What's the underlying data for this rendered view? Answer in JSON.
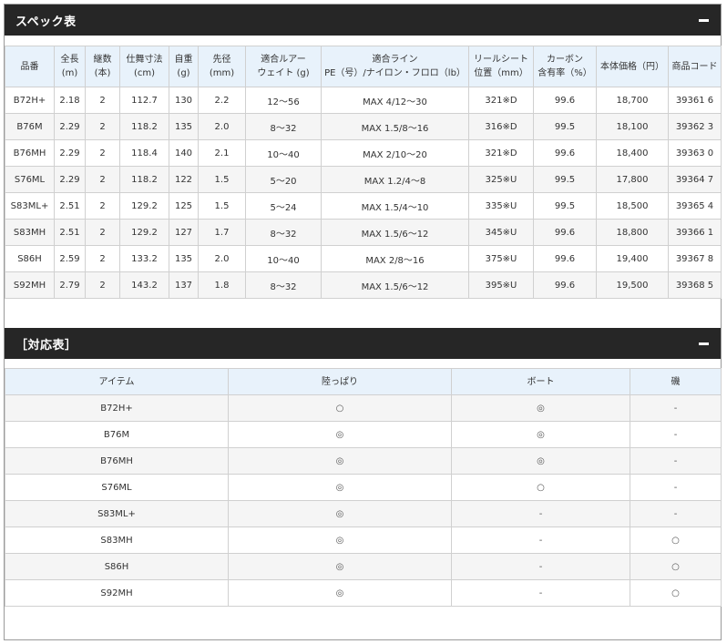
{
  "spec": {
    "title": "スペック表",
    "headers": [
      [
        "品番"
      ],
      [
        "全長",
        "(m)"
      ],
      [
        "継数",
        "(本)"
      ],
      [
        "仕舞寸法",
        "(cm)"
      ],
      [
        "自重",
        "(g)"
      ],
      [
        "先径",
        "(mm)"
      ],
      [
        "適合ルアー",
        "ウェイト (g)"
      ],
      [
        "適合ライン",
        "PE（号）/ナイロン・フロロ（lb）"
      ],
      [
        "リールシート",
        "位置（mm）"
      ],
      [
        "カーボン",
        "含有率（%）"
      ],
      [
        "本体価格（円）"
      ],
      [
        "商品コード"
      ]
    ],
    "rows": [
      [
        "B72H+",
        "2.18",
        "2",
        "112.7",
        "130",
        "2.2",
        "12～56",
        "MAX 4/12～30",
        "321※D",
        "99.6",
        "18,700",
        "39361 6"
      ],
      [
        "B76M",
        "2.29",
        "2",
        "118.2",
        "135",
        "2.0",
        "8～32",
        "MAX 1.5/8～16",
        "316※D",
        "99.5",
        "18,100",
        "39362 3"
      ],
      [
        "B76MH",
        "2.29",
        "2",
        "118.4",
        "140",
        "2.1",
        "10～40",
        "MAX 2/10～20",
        "321※D",
        "99.6",
        "18,400",
        "39363 0"
      ],
      [
        "S76ML",
        "2.29",
        "2",
        "118.2",
        "122",
        "1.5",
        "5～20",
        "MAX 1.2/4～8",
        "325※U",
        "99.5",
        "17,800",
        "39364 7"
      ],
      [
        "S83ML+",
        "2.51",
        "2",
        "129.2",
        "125",
        "1.5",
        "5～24",
        "MAX 1.5/4～10",
        "335※U",
        "99.5",
        "18,500",
        "39365 4"
      ],
      [
        "S83MH",
        "2.51",
        "2",
        "129.2",
        "127",
        "1.7",
        "8～32",
        "MAX 1.5/6～12",
        "345※U",
        "99.6",
        "18,800",
        "39366 1"
      ],
      [
        "S86H",
        "2.59",
        "2",
        "133.2",
        "135",
        "2.0",
        "10～40",
        "MAX 2/8～16",
        "375※U",
        "99.6",
        "19,400",
        "39367 8"
      ],
      [
        "S92MH",
        "2.79",
        "2",
        "143.2",
        "137",
        "1.8",
        "8～32",
        "MAX 1.5/6～12",
        "395※U",
        "99.6",
        "19,500",
        "39368 5"
      ]
    ]
  },
  "correspondence": {
    "title": "［対応表］",
    "headers": [
      "アイテム",
      "陸っぱり",
      "ボート",
      "磯"
    ],
    "rows": [
      [
        "B72H+",
        "○",
        "◎",
        "-"
      ],
      [
        "B76M",
        "◎",
        "◎",
        "-"
      ],
      [
        "B76MH",
        "◎",
        "◎",
        "-"
      ],
      [
        "S76ML",
        "◎",
        "○",
        "-"
      ],
      [
        "S83ML+",
        "◎",
        "-",
        "-"
      ],
      [
        "S83MH",
        "◎",
        "-",
        "○"
      ],
      [
        "S86H",
        "◎",
        "-",
        "○"
      ],
      [
        "S92MH",
        "◎",
        "-",
        "○"
      ]
    ]
  },
  "icons": {
    "collapse": "minus-icon"
  }
}
